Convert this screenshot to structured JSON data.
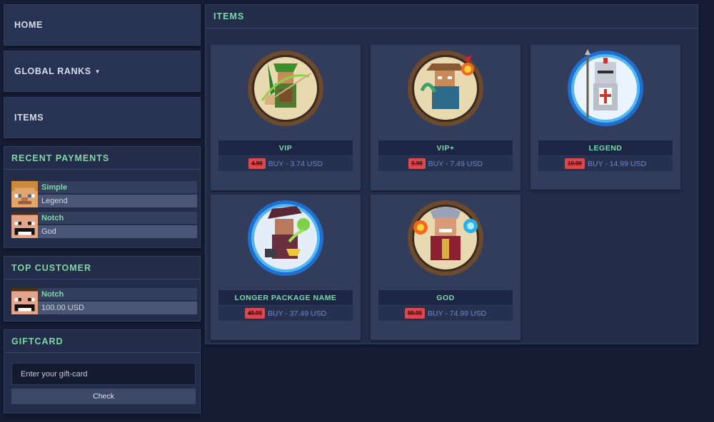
{
  "nav": {
    "home": "HOME",
    "global_ranks": "GLOBAL RANKS",
    "items": "ITEMS"
  },
  "recent_payments": {
    "title": "RECENT PAYMENTS",
    "entries": [
      {
        "name": "Simple",
        "package": "Legend",
        "avatar": "steve-avatar-icon"
      },
      {
        "name": "Notch",
        "package": "God",
        "avatar": "notch-avatar-icon"
      }
    ]
  },
  "top_customer": {
    "title": "TOP CUSTOMER",
    "name": "Notch",
    "amount": "100.00 USD"
  },
  "giftcard": {
    "title": "GIFTCARD",
    "placeholder": "Enter your gift-card",
    "check_label": "Check"
  },
  "items": {
    "title": "ITEMS",
    "packages": [
      {
        "name": "VIP",
        "old_price": "4.99",
        "buy": "BUY - 3.74 USD",
        "icon": "archer-icon"
      },
      {
        "name": "VIP+",
        "old_price": "9.99",
        "buy": "BUY - 7.49 USD",
        "icon": "fire-mage-icon"
      },
      {
        "name": "LEGEND",
        "old_price": "19.99",
        "buy": "BUY - 14.99 USD",
        "icon": "knight-icon"
      },
      {
        "name": "LONGER PACKAGE NAME",
        "old_price": "49.99",
        "buy": "BUY - 37.49 USD",
        "icon": "alchemist-icon"
      },
      {
        "name": "GOD",
        "old_price": "99.99",
        "buy": "BUY - 74.99 USD",
        "icon": "god-wizard-icon"
      }
    ]
  },
  "colors": {
    "accent_green": "#7fd8a8",
    "background": "#151c33",
    "panel": "#232c48",
    "sale_red": "#d9474f",
    "buy_blue": "#6f86c8"
  }
}
